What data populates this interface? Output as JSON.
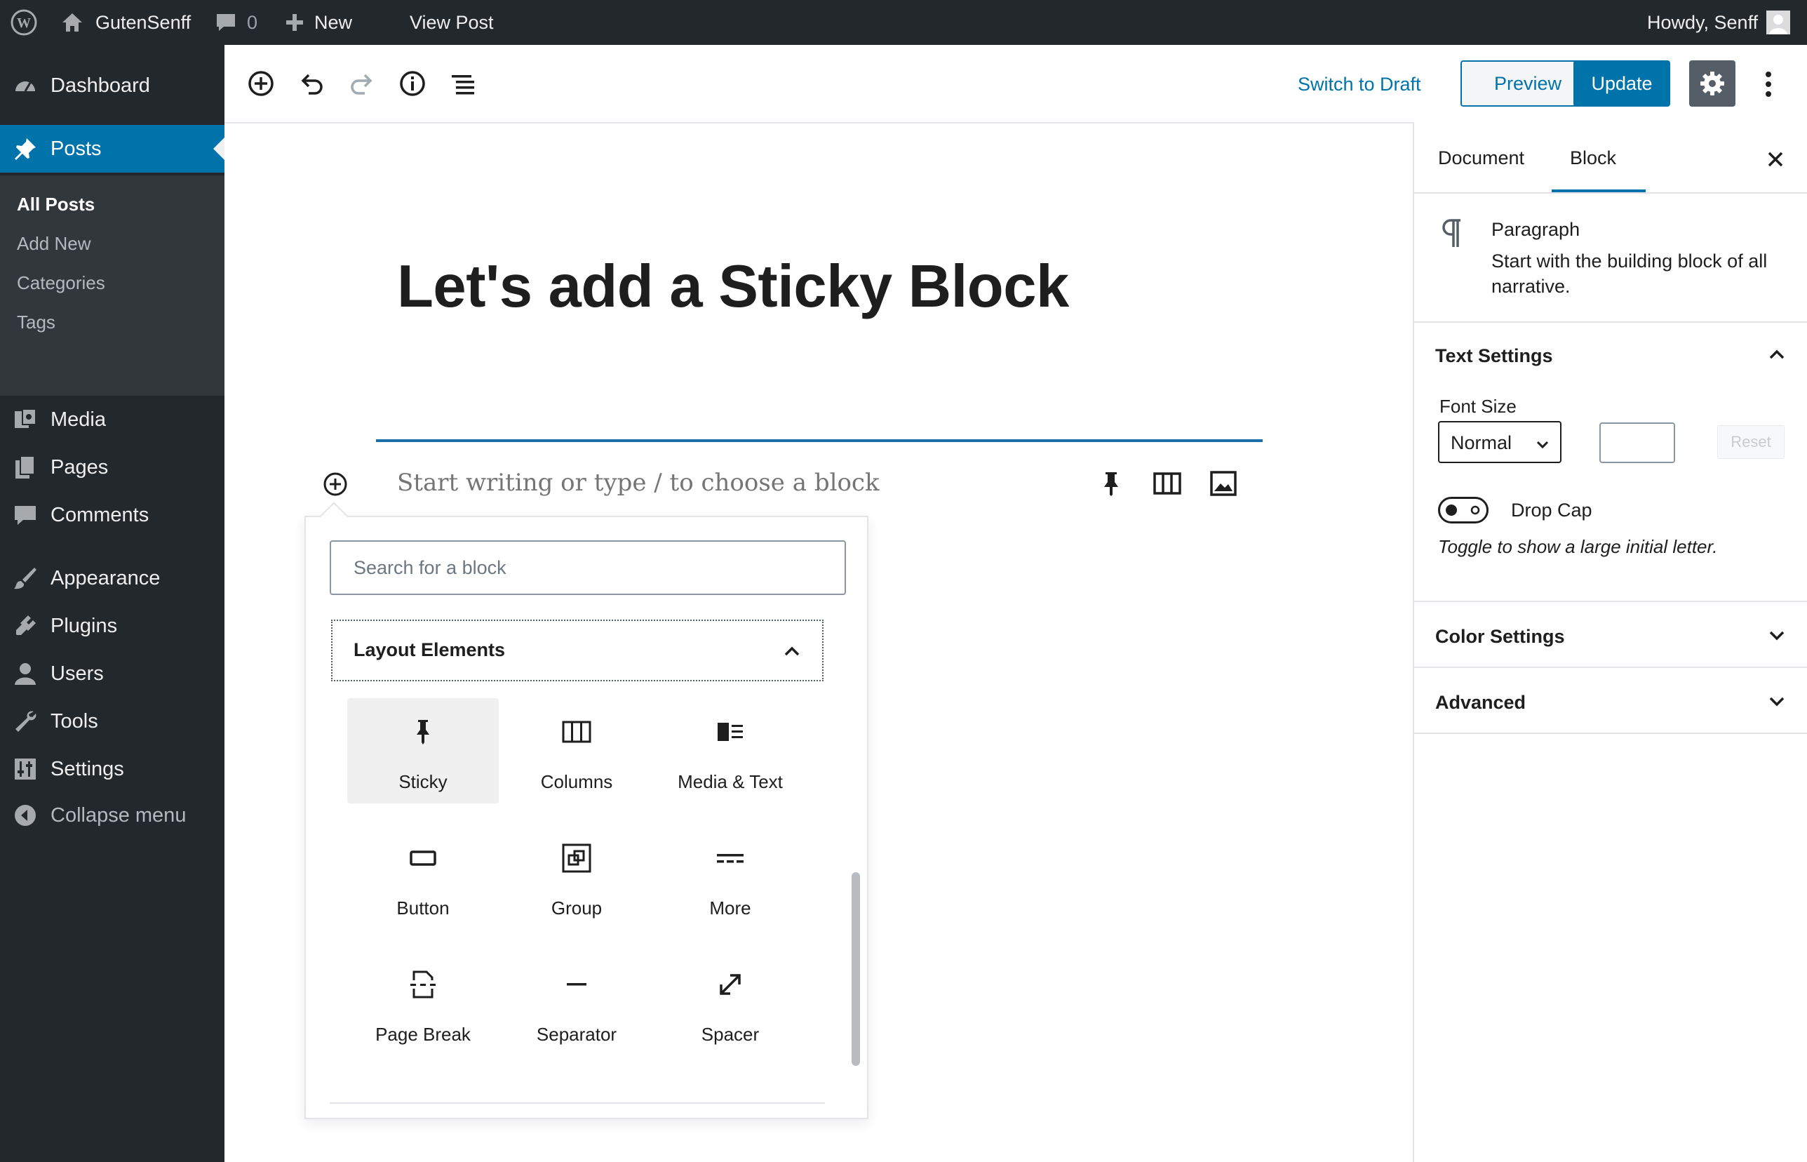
{
  "admin_bar": {
    "site_name": "GutenSenff",
    "comment_count": "0",
    "new_label": "New",
    "view_post_label": "View Post",
    "howdy": "Howdy, Senff"
  },
  "sidebar": {
    "items": [
      {
        "label": "Dashboard",
        "icon": "dashboard-icon"
      },
      {
        "label": "Posts",
        "icon": "pushpin-icon",
        "active": true
      },
      {
        "label": "Media",
        "icon": "media-icon"
      },
      {
        "label": "Pages",
        "icon": "pages-icon"
      },
      {
        "label": "Comments",
        "icon": "comments-icon"
      },
      {
        "label": "Appearance",
        "icon": "paintbrush-icon"
      },
      {
        "label": "Plugins",
        "icon": "plugins-icon"
      },
      {
        "label": "Users",
        "icon": "users-icon"
      },
      {
        "label": "Tools",
        "icon": "wrench-icon"
      },
      {
        "label": "Settings",
        "icon": "settings-sliders-icon"
      },
      {
        "label": "Collapse menu",
        "icon": "collapse-icon"
      }
    ],
    "submenu": [
      "All Posts",
      "Add New",
      "Categories",
      "Tags"
    ]
  },
  "toolbar": {
    "switch_draft": "Switch to Draft",
    "preview": "Preview",
    "update": "Update"
  },
  "editor": {
    "title": "Let's add a Sticky Block",
    "placeholder": "Start writing or type / to choose a block"
  },
  "inserter": {
    "search_placeholder": "Search for a block",
    "panel_title": "Layout Elements",
    "blocks": [
      {
        "label": "Sticky",
        "icon": "pushpin-icon",
        "selected": true
      },
      {
        "label": "Columns",
        "icon": "columns-icon"
      },
      {
        "label": "Media & Text",
        "icon": "media-text-icon"
      },
      {
        "label": "Button",
        "icon": "button-icon"
      },
      {
        "label": "Group",
        "icon": "group-icon"
      },
      {
        "label": "More",
        "icon": "more-icon"
      },
      {
        "label": "Page Break",
        "icon": "page-break-icon"
      },
      {
        "label": "Separator",
        "icon": "separator-icon"
      },
      {
        "label": "Spacer",
        "icon": "spacer-icon"
      }
    ]
  },
  "settings": {
    "tabs": [
      "Document",
      "Block"
    ],
    "active_tab": "Block",
    "block_name": "Paragraph",
    "block_description": "Start with the building block of all narrative.",
    "text_settings_title": "Text Settings",
    "font_size_label": "Font Size",
    "font_size_value": "Normal",
    "reset_label": "Reset",
    "drop_cap_label": "Drop Cap",
    "drop_cap_help": "Toggle to show a large initial letter.",
    "color_settings_title": "Color Settings",
    "advanced_title": "Advanced"
  },
  "colors": {
    "admin_dark": "#23282d",
    "submenu_dark": "#32373c",
    "accent_blue": "#0073aa"
  }
}
